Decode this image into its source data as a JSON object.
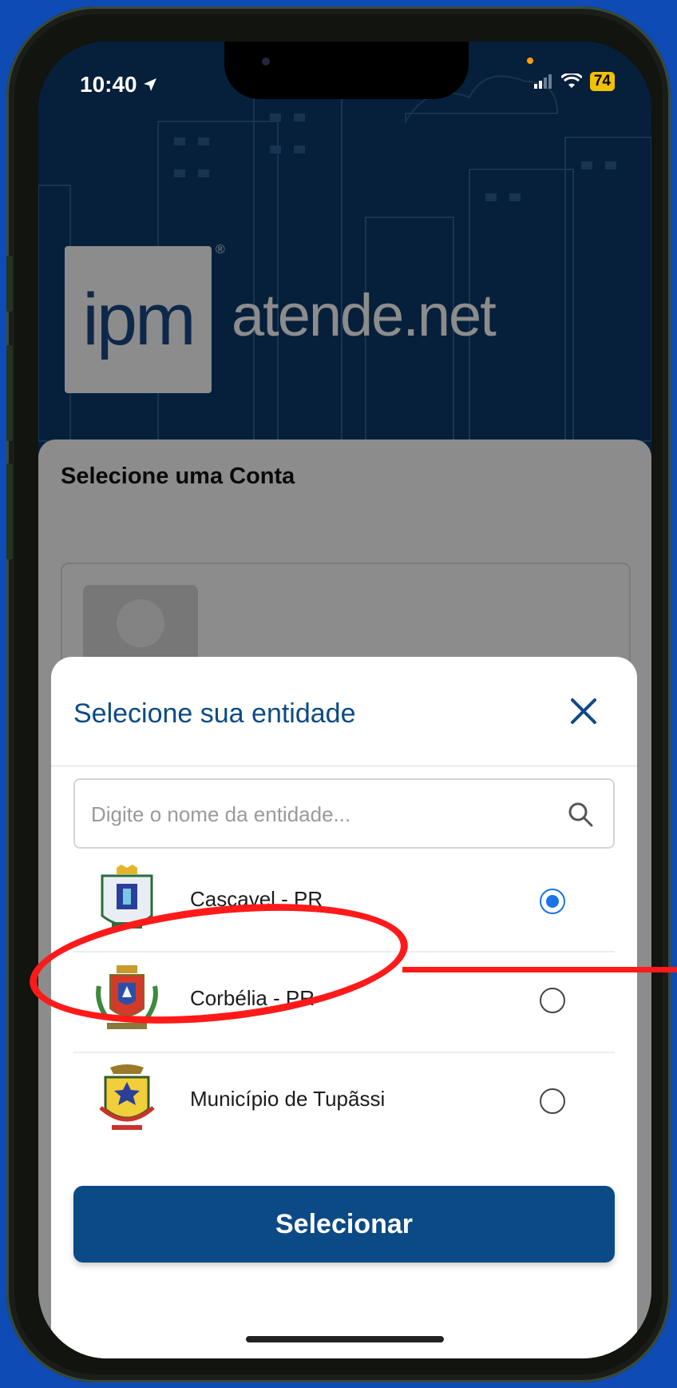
{
  "status_bar": {
    "time": "10:40",
    "battery": "74"
  },
  "brand": {
    "logo_mark": "ipm",
    "name_main": "atende",
    "name_suffix": ".net",
    "registered": "®"
  },
  "account": {
    "title": "Selecione uma Conta"
  },
  "sheet": {
    "title": "Selecione sua entidade",
    "close_icon": "close-icon",
    "search": {
      "placeholder": "Digite o nome da entidade...",
      "value": ""
    },
    "entities": [
      {
        "name": "Cascavel - PR",
        "selected": true
      },
      {
        "name": "Corbélia - PR",
        "selected": false
      },
      {
        "name": "Município de Tupãssi",
        "selected": false
      }
    ],
    "submit_label": "Selecionar"
  },
  "colors": {
    "primary": "#0c4a86",
    "radio_selected": "#1a73e8",
    "annotation": "#ff1a1a",
    "background": "#0f4bb4"
  }
}
